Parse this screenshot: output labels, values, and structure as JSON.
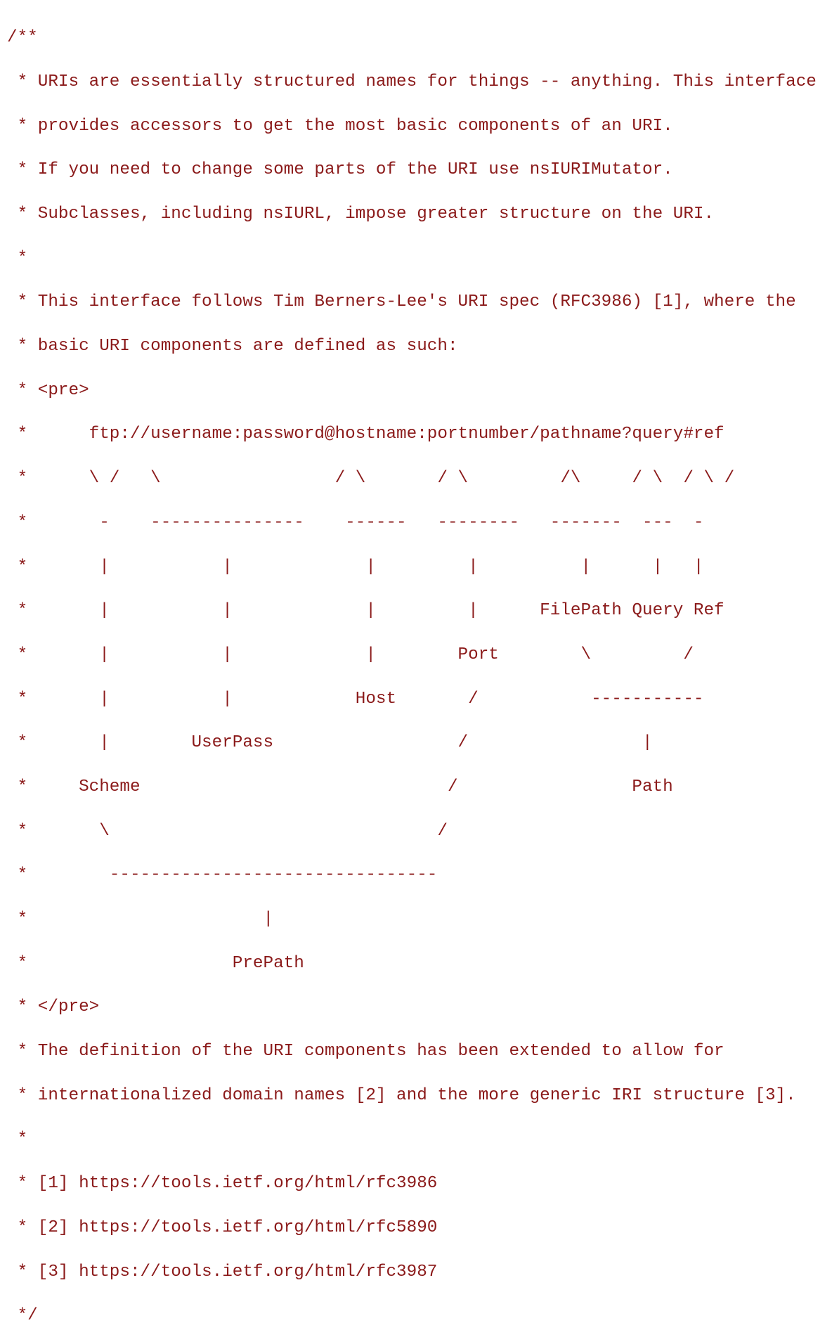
{
  "document": {
    "kind": "source-code-comment",
    "language": "idl",
    "background_color": "#ffffff",
    "text_color": "#8b1a1a",
    "line_count": 29
  },
  "code": {
    "lines": [
      "/**",
      " * URIs are essentially structured names for things -- anything. This interface",
      " * provides accessors to get the most basic components of an URI.",
      " * If you need to change some parts of the URI use nsIURIMutator.",
      " * Subclasses, including nsIURL, impose greater structure on the URI.",
      " *",
      " * This interface follows Tim Berners-Lee's URI spec (RFC3986) [1], where the",
      " * basic URI components are defined as such:",
      " * <pre>",
      " *      ftp://username:password@hostname:portnumber/pathname?query#ref",
      " *      \\ /   \\                 / \\       / \\         /\\     / \\  / \\ /",
      " *       -    ---------------    ------   --------   -------  ---  -",
      " *       |           |             |         |          |      |   |",
      " *       |           |             |         |      FilePath Query Ref",
      " *       |           |             |        Port        \\         /",
      " *       |           |            Host       /           -----------",
      " *       |        UserPass                  /                 |",
      " *     Scheme                              /                 Path",
      " *       \\                                /",
      " *        --------------------------------",
      " *                       |",
      " *                    PrePath",
      " * </pre>",
      " * The definition of the URI components has been extended to allow for",
      " * internationalized domain names [2] and the more generic IRI structure [3].",
      " *",
      " * [1] https://tools.ietf.org/html/rfc3986",
      " * [2] https://tools.ietf.org/html/rfc5890",
      " * [3] https://tools.ietf.org/html/rfc3987",
      " */"
    ],
    "diagram": {
      "example_uri": "ftp://username:password@hostname:portnumber/pathname?query#ref",
      "component_labels": [
        "Scheme",
        "UserPass",
        "Host",
        "Port",
        "FilePath",
        "Query",
        "Ref",
        "Path",
        "PrePath"
      ],
      "open_tag": "<pre>",
      "close_tag": "</pre>"
    },
    "references": [
      {
        "marker": "[1]",
        "url": "https://tools.ietf.org/html/rfc3986"
      },
      {
        "marker": "[2]",
        "url": "https://tools.ietf.org/html/rfc5890"
      },
      {
        "marker": "[3]",
        "url": "https://tools.ietf.org/html/rfc3987"
      }
    ],
    "prose": [
      "URIs are essentially structured names for things -- anything. This interface provides accessors to get the most basic components of an URI.",
      "If you need to change some parts of the URI use nsIURIMutator.",
      "Subclasses, including nsIURL, impose greater structure on the URI.",
      "This interface follows Tim Berners-Lee's URI spec (RFC3986) [1], where the basic URI components are defined as such:",
      "The definition of the URI components has been extended to allow for internationalized domain names [2] and the more generic IRI structure [3]."
    ],
    "comment_open": "/**",
    "comment_close": "*/"
  }
}
